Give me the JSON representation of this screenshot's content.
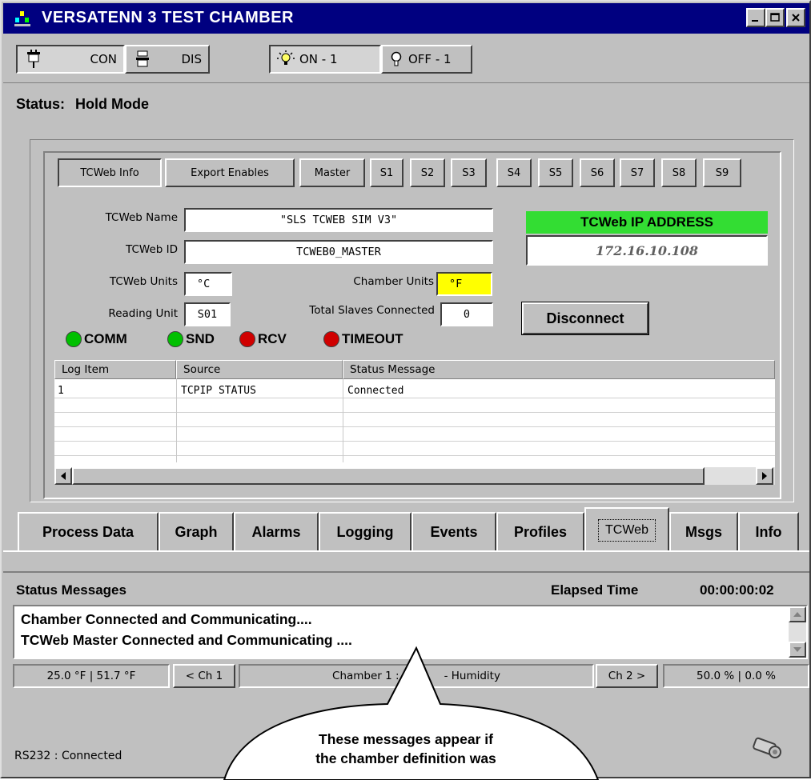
{
  "window": {
    "title": "VERSATENN 3 TEST CHAMBER"
  },
  "toolbar": {
    "connect_label": "CON",
    "disconnect_label": "DIS",
    "light_on_label": "ON - 1",
    "light_off_label": "OFF - 1"
  },
  "status": {
    "label": "Status:",
    "value": "Hold Mode"
  },
  "tcweb_tabs": [
    "TCWeb Info",
    "Export Enables",
    "Master",
    "S1",
    "S2",
    "S3",
    "S4",
    "S5",
    "S6",
    "S7",
    "S8",
    "S9"
  ],
  "tcweb_info": {
    "name_label": "TCWeb Name",
    "name_value": "\"SLS TCWEB SIM V3\"",
    "id_label": "TCWeb ID",
    "id_value": "TCWEB0_MASTER",
    "units_label": "TCWeb Units",
    "units_value": "°C",
    "chamber_units_label": "Chamber Units",
    "chamber_units_value": "°F",
    "reading_unit_label": "Reading Unit",
    "reading_unit_value": "S01",
    "total_slaves_label": "Total Slaves Connected",
    "total_slaves_value": "0",
    "ip_header": "TCWeb IP ADDRESS",
    "ip_value": "172.16.10.108",
    "disconnect_label": "Disconnect"
  },
  "indicators": [
    {
      "label": "COMM",
      "color": "#00c000"
    },
    {
      "label": "SND",
      "color": "#00c000"
    },
    {
      "label": "RCV",
      "color": "#d00000"
    },
    {
      "label": "TIMEOUT",
      "color": "#d00000"
    }
  ],
  "log": {
    "columns": [
      "Log Item",
      "Source",
      "Status Message"
    ],
    "rows": [
      [
        "1",
        "TCPIP STATUS",
        "Connected"
      ]
    ]
  },
  "main_tabs": [
    "Process Data",
    "Graph",
    "Alarms",
    "Logging",
    "Events",
    "Profiles",
    "TCWeb",
    "Msgs",
    "Info"
  ],
  "messages": {
    "title": "Status Messages",
    "elapsed_label": "Elapsed Time",
    "elapsed_value": "00:00:00:02",
    "lines": [
      "Chamber Connected and Communicating....",
      "TCWeb Master Connected and Communicating ...."
    ]
  },
  "statusbar": {
    "ch1_reading": "25.0 °F  |  51.7 °F",
    "prev_channel": "< Ch 1",
    "channel_name": "Chamber 1 :",
    "channel_name_tail": "- Humidity",
    "next_channel": "Ch 2 >",
    "ch2_reading": "50.0 %  |  0.0 %"
  },
  "connection": "RS232 : Connected",
  "callout": {
    "line1": "These messages appear if",
    "line2": "the chamber definition was"
  }
}
